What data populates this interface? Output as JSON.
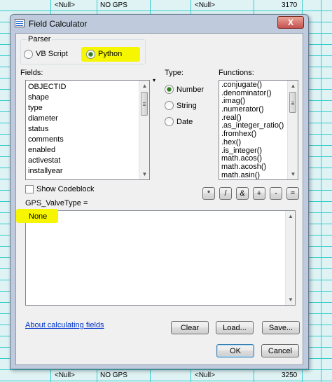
{
  "window": {
    "title": "Field Calculator",
    "close_label": "X"
  },
  "parser": {
    "label": "Parser",
    "options": [
      {
        "label": "VB Script",
        "checked": false
      },
      {
        "label": "Python",
        "checked": true
      }
    ]
  },
  "fields": {
    "label": "Fields:",
    "items": [
      "OBJECTID",
      "shape",
      "type",
      "diameter",
      "status",
      "comments",
      "enabled",
      "activestat",
      "installyear"
    ]
  },
  "type": {
    "label": "Type:",
    "options": [
      {
        "label": "Number",
        "checked": true
      },
      {
        "label": "String",
        "checked": false
      },
      {
        "label": "Date",
        "checked": false
      }
    ]
  },
  "functions": {
    "label": "Functions:",
    "items": [
      ".conjugate()",
      ".denominator()",
      ".imag()",
      ".numerator()",
      ".real()",
      ".as_integer_ratio()",
      ".fromhex()",
      ".hex()",
      ".is_integer()",
      "math.acos()",
      "math.acosh()",
      "math.asin()"
    ]
  },
  "codeblock": {
    "label": "Show Codeblock",
    "checked": false
  },
  "operators": [
    "*",
    "/",
    "&",
    "+",
    "-",
    "="
  ],
  "expression": {
    "label": "GPS_ValveType =",
    "value": "None"
  },
  "links": {
    "about": "About calculating fields"
  },
  "buttons": {
    "clear": "Clear",
    "load": "Load...",
    "save": "Save...",
    "ok": "OK",
    "cancel": "Cancel"
  },
  "background_table": {
    "top_row": [
      "<Null>",
      "NO GPS",
      "<Null>",
      "3170"
    ],
    "bottom_row": [
      "<Null>",
      "NO GPS",
      "<Null>",
      "3250"
    ]
  },
  "colors": {
    "highlight": "#f6f600",
    "grid": "#33cccc",
    "table_bg": "#dff3f5"
  }
}
